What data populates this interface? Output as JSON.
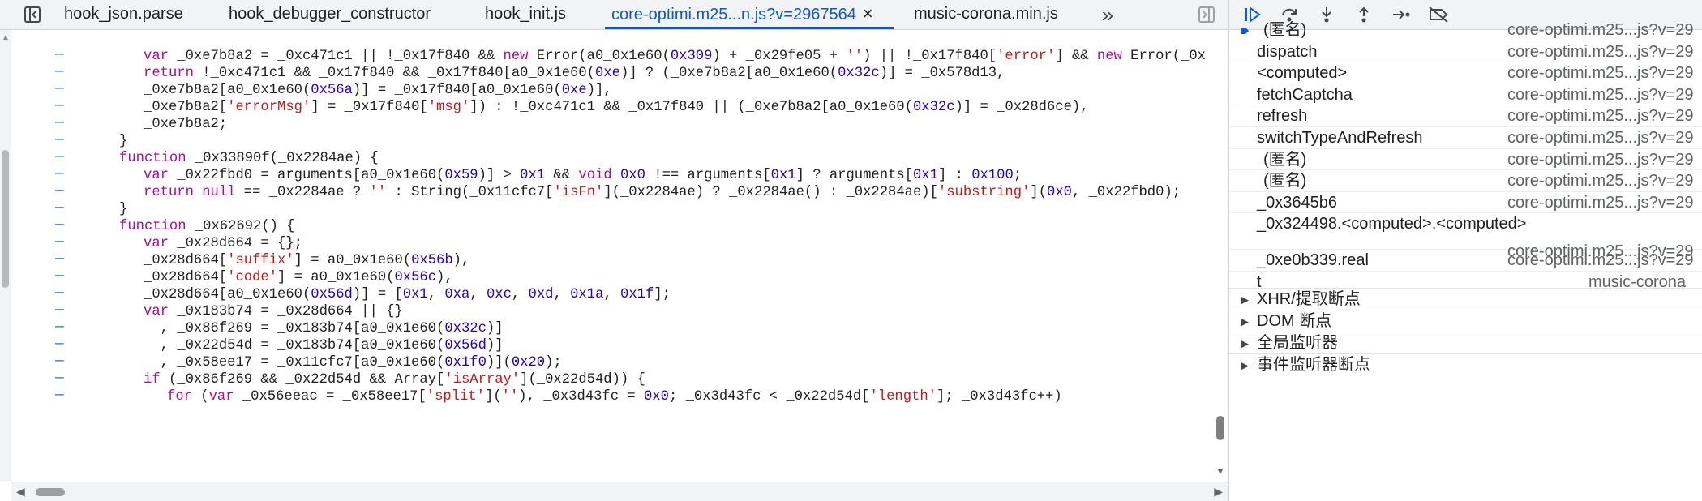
{
  "editor": {
    "tabs": [
      {
        "label": "hook_json.parse"
      },
      {
        "label": "hook_debugger_constructor"
      },
      {
        "label": "hook_init.js"
      },
      {
        "label": "core-optimi.m25...n.js?v=2967564",
        "active": true
      },
      {
        "label": "music-corona.min.js"
      }
    ],
    "close_glyph": "×",
    "overflow_glyph": "»",
    "gutter_marker": "–",
    "lines": [
      {
        "indent": 2,
        "html": "var _0xe7b8a2 = _0xc471c1 || !_0x17f840 && new Error(a0_0x1e60(0x309) + _0x29fe05 + '') || !_0x17f840['error'] && new Error(_0x"
      },
      {
        "indent": 2,
        "html": "return !_0xc471c1 && _0x17f840 && _0x17f840[a0_0x1e60(0xe)] ? (_0xe7b8a2[a0_0x1e60(0x32c)] = _0x578d13,"
      },
      {
        "indent": 2,
        "html": "_0xe7b8a2[a0_0x1e60(0x56a)] = _0x17f840[a0_0x1e60(0xe)],"
      },
      {
        "indent": 2,
        "html": "_0xe7b8a2['errorMsg'] = _0x17f840['msg']) : !_0xc471c1 && _0x17f840 || (_0xe7b8a2[a0_0x1e60(0x32c)] = _0x28d6ce),"
      },
      {
        "indent": 2,
        "html": "_0xe7b8a2;"
      },
      {
        "indent": 1,
        "html": "}"
      },
      {
        "indent": 1,
        "html": "function _0x33890f(_0x2284ae) {"
      },
      {
        "indent": 2,
        "html": "var _0x22fbd0 = arguments[a0_0x1e60(0x59)] > 0x1 && void 0x0 !== arguments[0x1] ? arguments[0x1] : 0x100;"
      },
      {
        "indent": 2,
        "html": "return null == _0x2284ae ? '' : String(_0x11cfc7['isFn'](_0x2284ae) ? _0x2284ae() : _0x2284ae)['substring'](0x0, _0x22fbd0);"
      },
      {
        "indent": 1,
        "html": "}"
      },
      {
        "indent": 1,
        "html": "function _0x62692() {"
      },
      {
        "indent": 2,
        "html": "var _0x28d664 = {};"
      },
      {
        "indent": 2,
        "html": "_0x28d664['suffix'] = a0_0x1e60(0x56b),"
      },
      {
        "indent": 2,
        "html": "_0x28d664['code'] = a0_0x1e60(0x56c),"
      },
      {
        "indent": 2,
        "html": "_0x28d664[a0_0x1e60(0x56d)] = [0x1, 0xa, 0xc, 0xd, 0x1a, 0x1f];"
      },
      {
        "indent": 2,
        "html": "var _0x183b74 = _0x28d664 || {}"
      },
      {
        "indent": 2,
        "html": "  , _0x86f269 = _0x183b74[a0_0x1e60(0x32c)]"
      },
      {
        "indent": 2,
        "html": "  , _0x22d54d = _0x183b74[a0_0x1e60(0x56d)]"
      },
      {
        "indent": 2,
        "html": "  , _0x58ee17 = _0x11cfc7[a0_0x1e60(0x1f0)](0x20);"
      },
      {
        "indent": 2,
        "html": "if (_0x86f269 && _0x22d54d && Array['isArray'](_0x22d54d)) {"
      },
      {
        "indent": 3,
        "html": "for (var _0x56eeac = _0x58ee17['split'](''), _0x3d43fc = 0x0; _0x3d43fc < _0x22d54d['length']; _0x3d43fc++)"
      }
    ]
  },
  "debugger": {
    "toolbar_icons": [
      "resume-icon",
      "step-over-icon",
      "step-into-icon",
      "step-out-icon",
      "step-icon",
      "deactivate-breakpoints-icon"
    ],
    "call_stack": [
      {
        "name": "(匿名)",
        "location": "core-optimi.m25...js?v=29",
        "anon": true,
        "current": true
      },
      {
        "name": "dispatch",
        "location": "core-optimi.m25...js?v=29"
      },
      {
        "name": "<computed>",
        "location": "core-optimi.m25...js?v=29"
      },
      {
        "name": "fetchCaptcha",
        "location": "core-optimi.m25...js?v=29"
      },
      {
        "name": "refresh",
        "location": "core-optimi.m25...js?v=29"
      },
      {
        "name": "switchTypeAndRefresh",
        "location": "core-optimi.m25...js?v=29"
      },
      {
        "name": "(匿名)",
        "location": "core-optimi.m25...js?v=29",
        "anon": true
      },
      {
        "name": "(匿名)",
        "location": "core-optimi.m25...js?v=29",
        "anon": true
      },
      {
        "name": "_0x3645b6",
        "location": "core-optimi.m25...js?v=29"
      },
      {
        "name": "_0x324498.<computed>.<computed>",
        "location": "core-optimi.m25...js?v=29",
        "two_line": true
      },
      {
        "name": "_0xe0b339.real",
        "location": "core-optimi.m25...js?v=29"
      },
      {
        "name": "t",
        "location": "music-corona"
      }
    ],
    "sections": [
      {
        "title": "XHR/提取断点"
      },
      {
        "title": "DOM 断点"
      },
      {
        "title": "全局监听器"
      },
      {
        "title": "事件监听器断点"
      }
    ],
    "section_arrow": "▶"
  }
}
